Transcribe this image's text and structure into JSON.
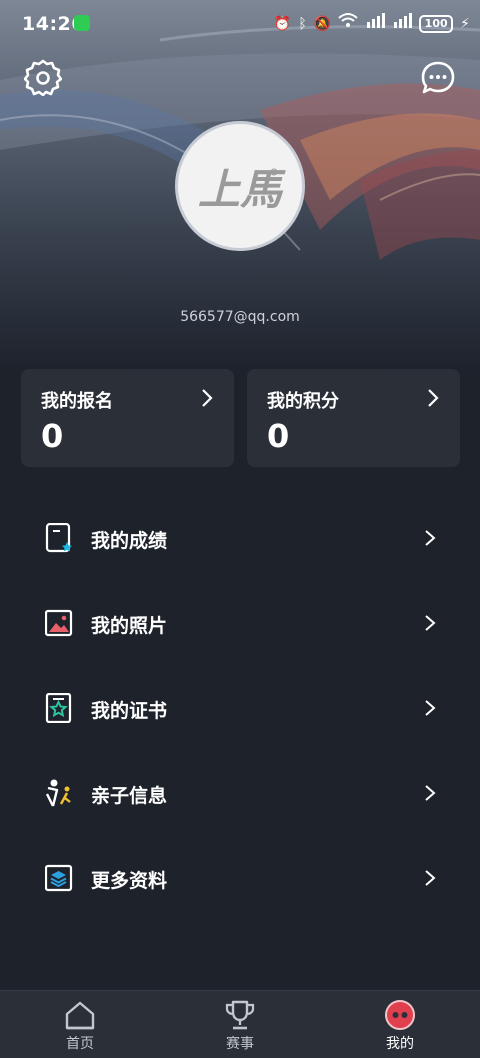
{
  "status_bar": {
    "time": "14:26",
    "battery": "100",
    "icons": [
      "alarm-icon",
      "bluetooth-icon",
      "mute-icon",
      "wifi-icon",
      "signal-4g-icon",
      "signal-4g-icon",
      "battery-icon",
      "charging-icon"
    ]
  },
  "profile": {
    "logo_text": "上馬",
    "email": "566577@qq.com"
  },
  "stats": [
    {
      "title": "我的报名",
      "value": "0"
    },
    {
      "title": "我的积分",
      "value": "0"
    }
  ],
  "menu": {
    "items": [
      {
        "label": "我的成绩",
        "icon": "scorecard-icon",
        "accent": "#1fb6e6"
      },
      {
        "label": "我的照片",
        "icon": "photo-icon",
        "accent": "#e8606a"
      },
      {
        "label": "我的证书",
        "icon": "certificate-icon",
        "accent": "#2ec4a0"
      },
      {
        "label": "亲子信息",
        "icon": "family-runner-icon",
        "accent": "#f2c12e"
      },
      {
        "label": "更多资料",
        "icon": "layers-icon",
        "accent": "#2aa0e0"
      }
    ]
  },
  "tabbar": {
    "tabs": [
      {
        "label": "首页",
        "icon": "home-icon"
      },
      {
        "label": "赛事",
        "icon": "trophy-icon"
      },
      {
        "label": "我的",
        "icon": "profile-avatar-icon",
        "active": true
      }
    ]
  },
  "colors": {
    "background": "#1d222b",
    "card": "#2b3038",
    "tabbar": "#2a2f38",
    "active_tab_badge": "#e0404e"
  }
}
